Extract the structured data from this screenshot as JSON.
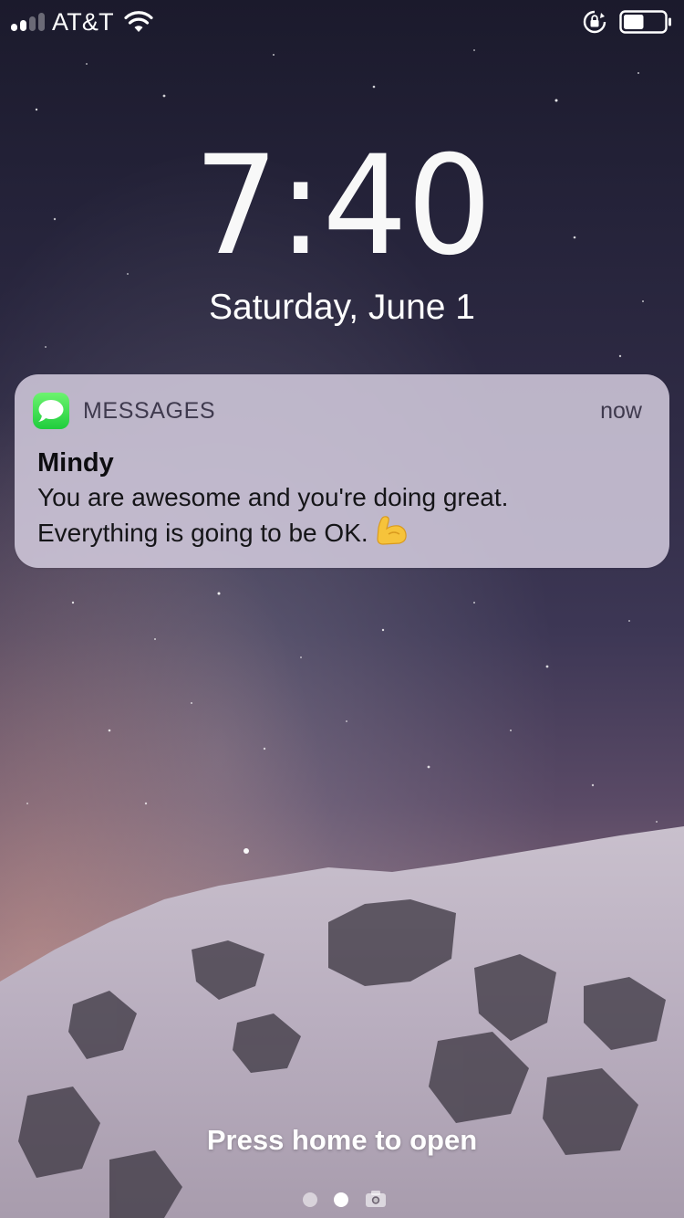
{
  "status_bar": {
    "carrier": "AT&T",
    "signal_bars_filled": 2,
    "signal_bars_total": 4,
    "battery_level": 0.5,
    "icons": [
      "signal-icon",
      "wifi-icon",
      "rotation-lock-icon",
      "battery-icon"
    ]
  },
  "lock_screen": {
    "time": "7:40",
    "date": "Saturday, June 1"
  },
  "notification": {
    "app_name": "MESSAGES",
    "time": "now",
    "sender": "Mindy",
    "message_line1": "You are awesome and you're doing great.",
    "message_line2": "Everything is going to be OK.",
    "emoji": "flexed-biceps-icon",
    "app_icon": "messages-app-icon",
    "app_icon_color": "#34C759"
  },
  "footer": {
    "prompt": "Press home to open",
    "page_indicator_count": 3,
    "page_indicator_active": 1,
    "page_indicator_last_icon": "camera-icon"
  },
  "colors": {
    "notification_background": "#D4CCDE",
    "text_primary": "#FFFFFF",
    "sky_top": "#1B1A2C",
    "sky_horizon": "#B8A8B4"
  }
}
